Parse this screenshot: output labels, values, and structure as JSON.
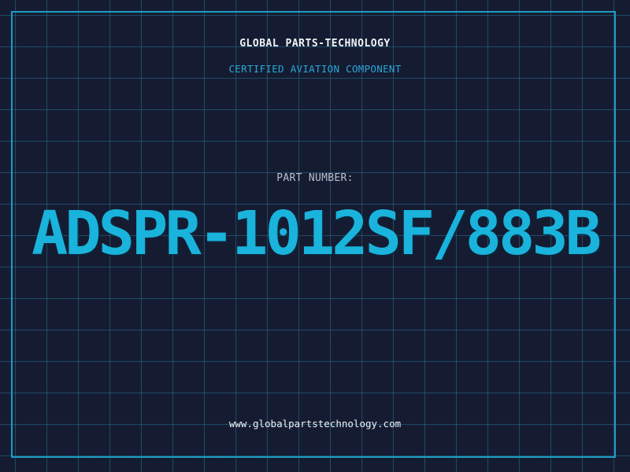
{
  "brand": "GLOBAL PARTS-TECHNOLOGY",
  "subtitle": "CERTIFIED AVIATION COMPONENT",
  "part_label": "PART NUMBER:",
  "part_number": "ADSPR-1012SF/883B",
  "website": "www.globalpartstechnology.com",
  "colors": {
    "background": "#151c32",
    "grid": "#286e8c",
    "accent": "#19b3dc",
    "frame": "#1d9cc4",
    "text": "#f2f4f8"
  }
}
